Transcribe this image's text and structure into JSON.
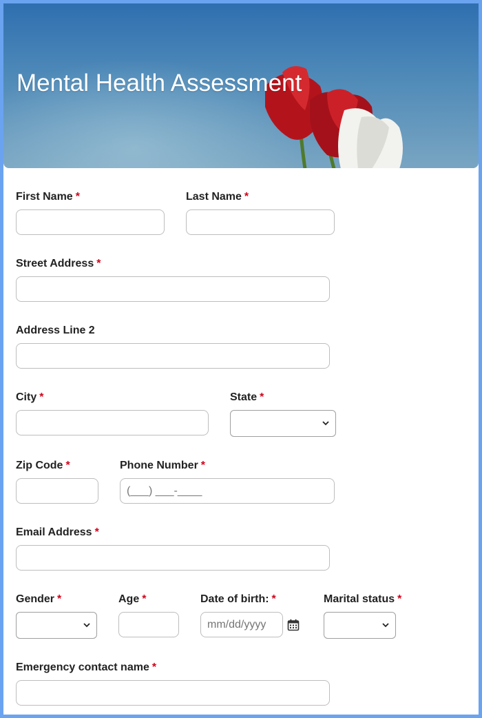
{
  "header": {
    "title": "Mental Health Assessment"
  },
  "form": {
    "required_mark": "*",
    "first_name": {
      "label": "First Name",
      "value": ""
    },
    "last_name": {
      "label": "Last Name",
      "value": ""
    },
    "street_address": {
      "label": "Street Address",
      "value": ""
    },
    "address_line_2": {
      "label": "Address Line 2",
      "value": ""
    },
    "city": {
      "label": "City",
      "value": ""
    },
    "state": {
      "label": "State",
      "selected": ""
    },
    "zip_code": {
      "label": "Zip Code",
      "value": ""
    },
    "phone_number": {
      "label": "Phone Number",
      "placeholder": "(___) ___-____"
    },
    "email_address": {
      "label": "Email Address",
      "value": ""
    },
    "gender": {
      "label": "Gender",
      "selected": ""
    },
    "age": {
      "label": "Age",
      "value": ""
    },
    "date_of_birth": {
      "label": "Date of birth:",
      "placeholder": "mm/dd/yyyy"
    },
    "marital_status": {
      "label": "Marital status",
      "selected": ""
    },
    "emergency_contact_name": {
      "label": "Emergency contact name",
      "value": ""
    }
  },
  "icons": {
    "select_arrow": "chevron-down-icon",
    "date_picker": "calendar-icon"
  },
  "colors": {
    "page_border": "#6aa3f0",
    "required": "#d0021b",
    "title": "#ffffff"
  }
}
